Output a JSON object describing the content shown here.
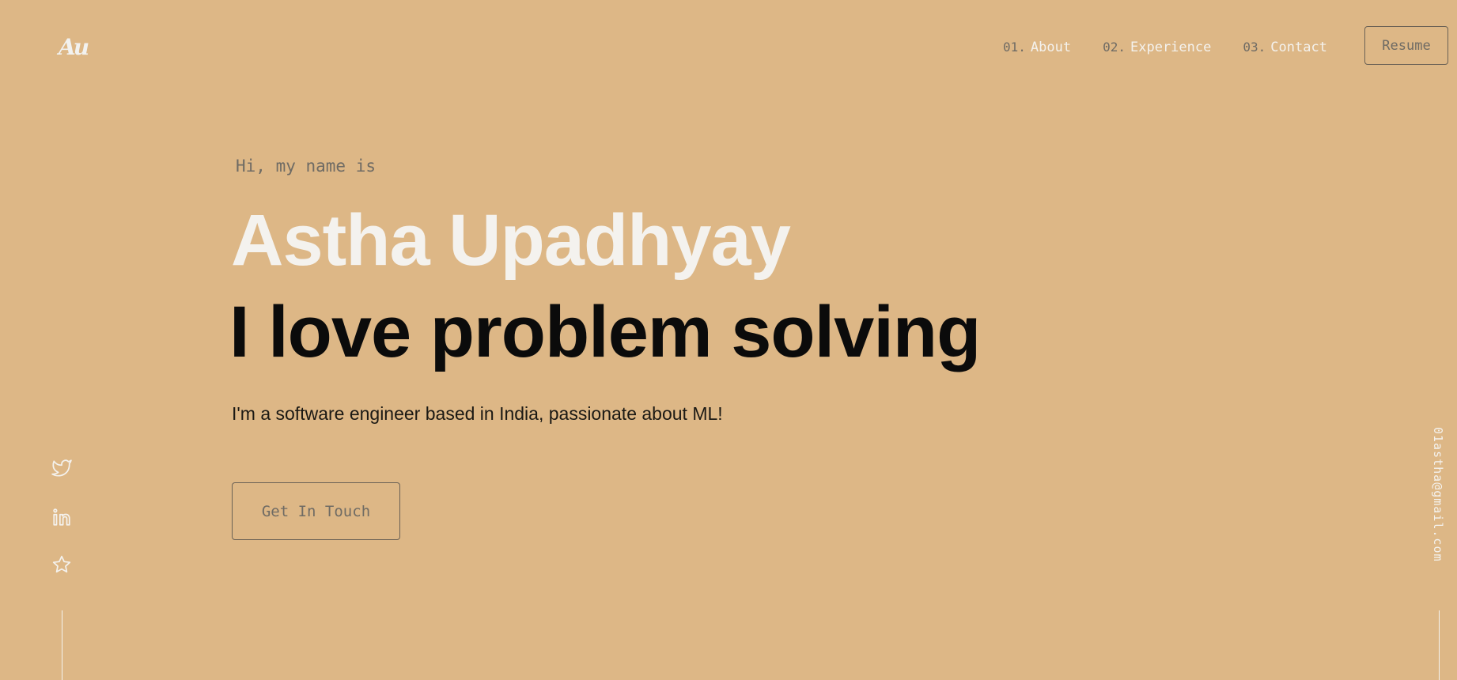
{
  "header": {
    "logo_text": "Au",
    "nav": [
      {
        "num": "01.",
        "label": "About"
      },
      {
        "num": "02.",
        "label": "Experience"
      },
      {
        "num": "03.",
        "label": "Contact"
      }
    ],
    "resume_label": "Resume"
  },
  "hero": {
    "greeting": "Hi, my name is",
    "name": "Astha Upadhyay",
    "tagline": "I love problem solving",
    "intro": "I'm a software engineer based in India, passionate about ML!",
    "cta_label": "Get In Touch"
  },
  "social": {
    "icons": [
      "twitter-icon",
      "linkedin-icon",
      "star-icon"
    ]
  },
  "email": "01astha@gmail.com",
  "colors": {
    "background": "#ddb786",
    "light_text": "#f4f2ee",
    "muted_text": "#6f6b64",
    "dark_text": "#0b0b0b",
    "border": "#6a6155"
  }
}
